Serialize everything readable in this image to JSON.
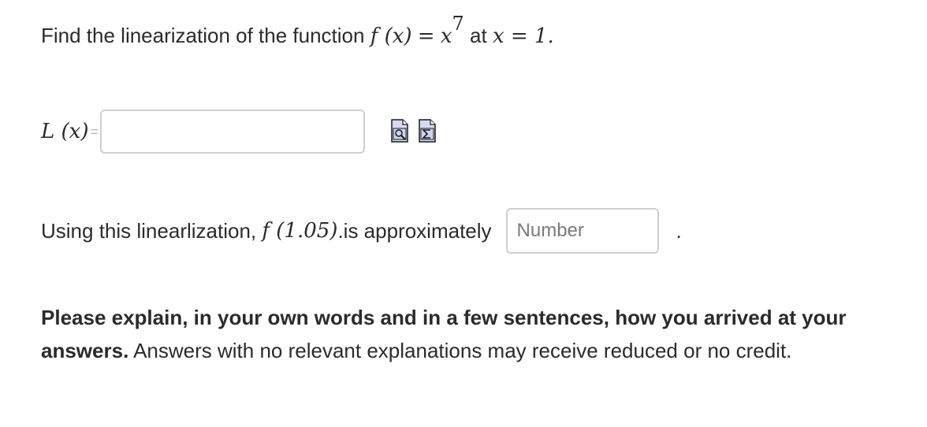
{
  "question1": {
    "prefix": "Find the linearization of the function",
    "f_x": "f (x)",
    "equals": "=",
    "base": "x",
    "exponent": "7",
    "at_text": "at",
    "x_eq": "x = 1."
  },
  "linearization_row": {
    "label": "L (x)",
    "equals": "=",
    "value": ""
  },
  "icons": {
    "preview": "preview-icon",
    "equation": "equation-editor-icon"
  },
  "question2": {
    "prefix": "Using this linearlization,",
    "f_expr": "f (1.05)",
    "suffix": ".is approximately",
    "placeholder": "Number",
    "value": "",
    "trailing": "."
  },
  "explanation": {
    "bold": "Please explain, in your own words and in a few sentences, how you arrived at your answers.",
    "normal": " Answers with no relevant explanations may receive reduced or no credit."
  }
}
